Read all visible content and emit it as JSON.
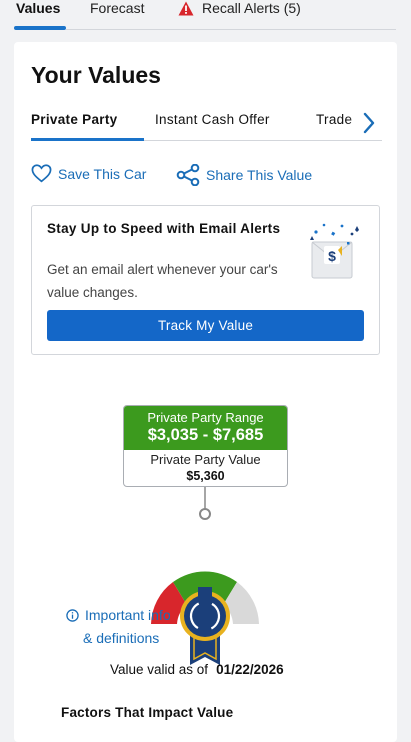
{
  "top_tabs": {
    "values": "Values",
    "forecast": "Forecast",
    "recall": "Recall Alerts (5)"
  },
  "card": {
    "title": "Your Values",
    "value_tabs": [
      "Private Party",
      "Instant Cash Offer",
      "Trade"
    ],
    "save_label": "Save This Car",
    "share_label": "Share This Value"
  },
  "email_alert": {
    "heading": "Stay Up to Speed with Email Alerts",
    "description": "Get an email alert whenever your car's value changes.",
    "button": "Track My Value"
  },
  "range": {
    "label": "Private Party Range",
    "value": "$3,035 - $7,685",
    "pp_label": "Private Party Value",
    "pp_value": "$5,360"
  },
  "info": {
    "line1": "Important info",
    "line2": "& definitions"
  },
  "validity": {
    "prefix": "Value valid as of",
    "date": "01/22/2026"
  },
  "factors_heading": "Factors That Impact Value",
  "colors": {
    "accent": "#1a73c9",
    "button": "#1467c8",
    "range_green": "#3c9a1e",
    "gauge_red": "#d8262c",
    "gauge_grey": "#d9d9d9",
    "ribbon_navy": "#1b3f7a",
    "ribbon_gold": "#e8b21f"
  }
}
